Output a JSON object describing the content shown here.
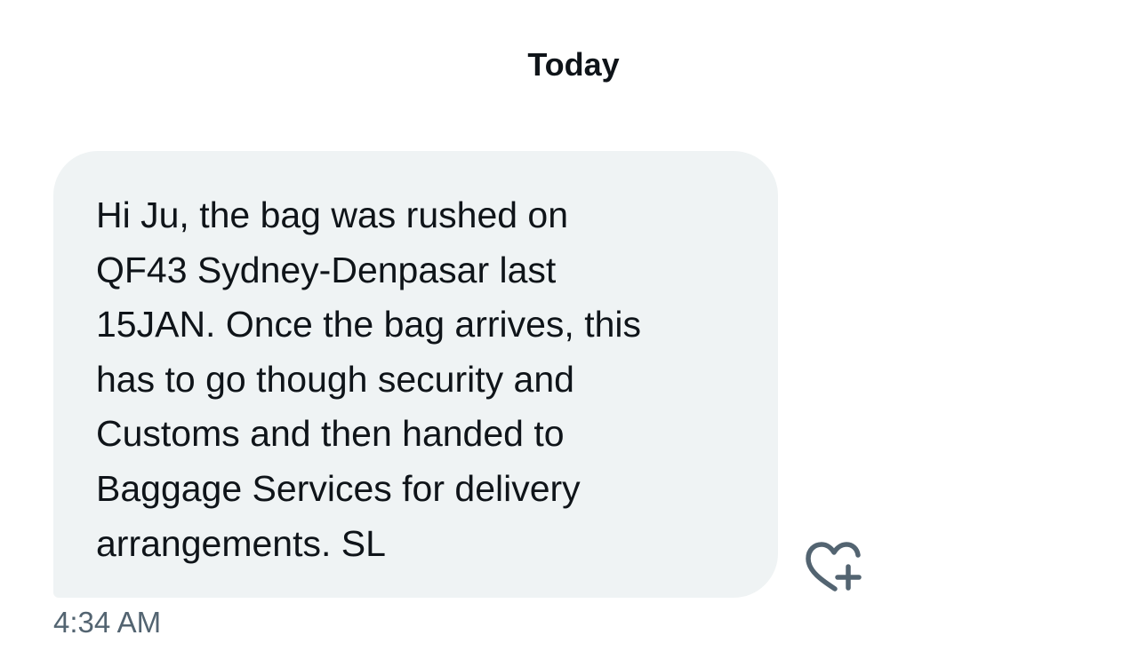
{
  "conversation": {
    "day_label": "Today"
  },
  "message": {
    "lines": [
      "Hi Ju, the bag was rushed on",
      "QF43 Sydney-Denpasar last",
      "15JAN. Once the bag arrives, this",
      "has to go though security and",
      "Customs and then handed to",
      "Baggage Services for delivery",
      "arrangements. SL"
    ],
    "timestamp": "4:34 AM",
    "reaction_icon": "heart-plus-icon"
  },
  "colors": {
    "bubble_background": "#eff3f4",
    "text": "#0f1419",
    "secondary_text": "#536471"
  }
}
